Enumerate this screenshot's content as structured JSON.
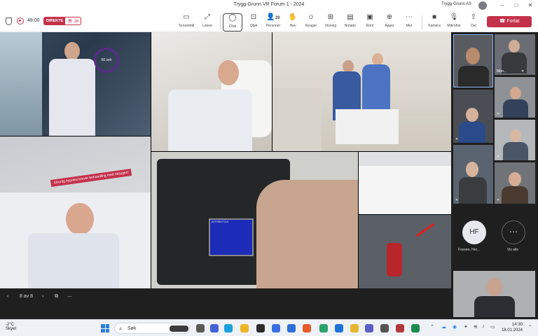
{
  "window": {
    "title": "Trygg-Grunn VR Forum 1 - 2024",
    "account": "Trygg-Grunn AS"
  },
  "meeting": {
    "elapsed": "48:00",
    "live_label": "DIREKTE",
    "viewer_count": "16",
    "toolbar": [
      {
        "label": "Ta kontroll",
        "icon": "cast-icon"
      },
      {
        "label": "Løsne",
        "icon": "popout-icon"
      },
      {
        "label": "Chat",
        "icon": "chat-icon"
      },
      {
        "label": "Q&A",
        "icon": "qa-icon"
      },
      {
        "label": "Personer",
        "icon": "people-icon",
        "badge": "20"
      },
      {
        "label": "Hev",
        "icon": "raise-hand-icon"
      },
      {
        "label": "Reager",
        "icon": "react-icon"
      },
      {
        "label": "Visning",
        "icon": "view-icon"
      },
      {
        "label": "Notater",
        "icon": "notes-icon"
      },
      {
        "label": "Rom",
        "icon": "rooms-icon"
      },
      {
        "label": "Apper",
        "icon": "apps-icon"
      },
      {
        "label": "Mer",
        "icon": "more-icon"
      },
      {
        "label": "Kamera",
        "icon": "camera-icon"
      },
      {
        "label": "Mikrofon",
        "icon": "mic-off-icon"
      },
      {
        "label": "Del",
        "icon": "share-icon"
      }
    ],
    "leave_label": "Forlat"
  },
  "slide": {
    "timer_text": "60 sek",
    "banner_text": "Alvorlig hypoksi krever behandling med oksygen!",
    "panel_text": "AUTOMATIKA",
    "page": "8 av 8"
  },
  "participants": [
    {
      "name": "",
      "muted": false
    },
    {
      "name": "Mon...",
      "muted": true
    },
    {
      "name": "",
      "muted": true
    },
    {
      "name": "",
      "muted": true
    },
    {
      "name": "",
      "muted": true
    },
    {
      "name": "",
      "muted": true
    },
    {
      "name": "",
      "muted": true
    },
    {
      "name": "",
      "muted": true
    }
  ],
  "extra": {
    "initials": "HF",
    "initials_name": "Fossen, Hei...",
    "view_all": "Vis alle"
  },
  "taskbar": {
    "temperature": "-2°C",
    "weather": "Skyet",
    "search": "Søk",
    "time": "14:30",
    "date": "18.01.2024"
  },
  "colors": {
    "accent_red": "#c4314b",
    "brand_blue": "#2d7ee0"
  }
}
